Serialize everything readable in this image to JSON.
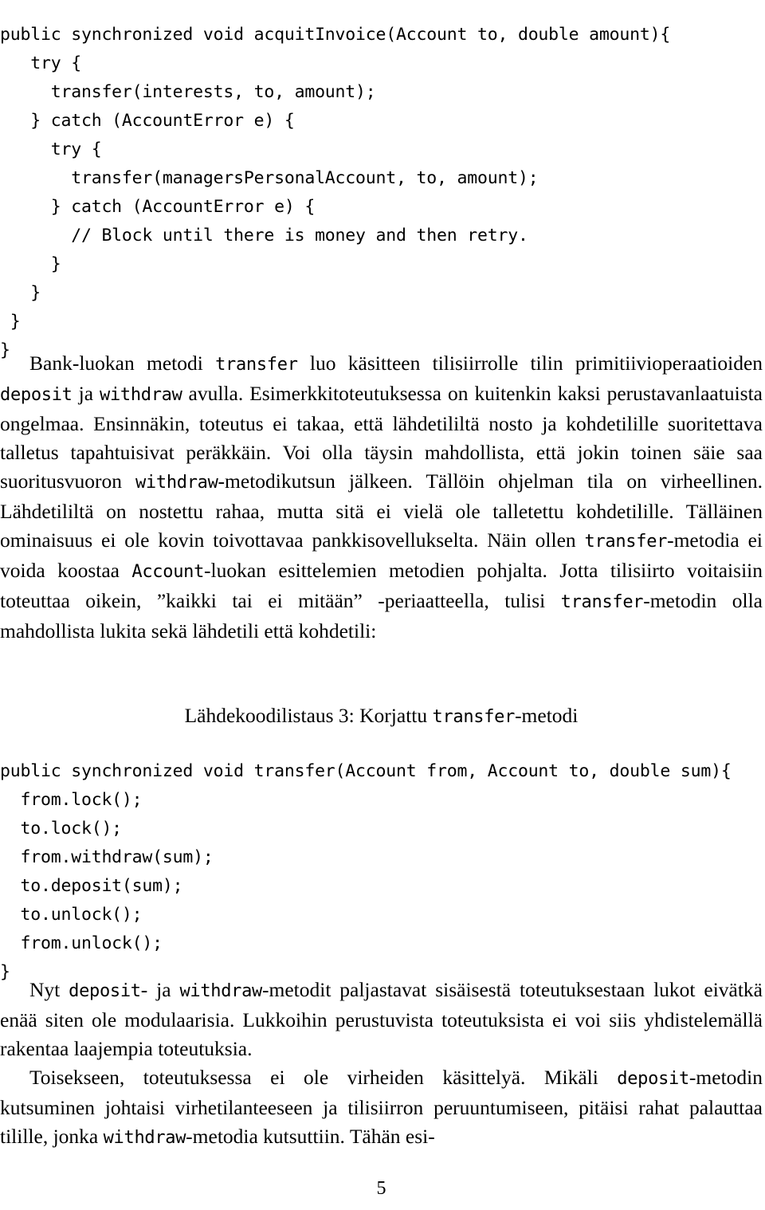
{
  "page": {
    "number": "5",
    "language": "fi"
  },
  "code_listing_1": {
    "language": "java",
    "lines": [
      "public synchronized void acquitInvoice(Account to, double amount){",
      "   try {",
      "     transfer(interests, to, amount);",
      "   } catch (AccountError e) {",
      "     try {",
      "       transfer(managersPersonalAccount, to, amount);",
      "     } catch (AccountError e) {",
      "       // Block until there is money and then retry.",
      "     }",
      "   }",
      " }",
      "}"
    ]
  },
  "paragraph_1": {
    "runs": [
      {
        "t": "Bank-luokan metodi ",
        "m": false
      },
      {
        "t": "transfer",
        "m": true
      },
      {
        "t": " luo käsitteen tilisiirrolle tilin primitiivioperaatioiden ",
        "m": false
      },
      {
        "t": "deposit",
        "m": true
      },
      {
        "t": " ja ",
        "m": false
      },
      {
        "t": "withdraw",
        "m": true
      },
      {
        "t": " avulla. Esimerkkitoteutuksessa on kuitenkin kaksi perustavanlaatuista ongelmaa. Ensinnäkin, toteutus ei takaa, että lähdetililtä nosto ja kohdetilille suoritettava talletus tapahtuisivat peräkkäin. Voi olla täysin mahdollista, että jokin toinen säie saa suoritusvuoron ",
        "m": false
      },
      {
        "t": "withdraw",
        "m": true
      },
      {
        "t": "-metodikutsun jälkeen. Tällöin ohjelman tila on virheellinen. Lähdetililtä on nostettu rahaa, mutta sitä ei vielä ole talletettu kohdetilille. Tälläinen ominaisuus ei ole kovin toivottavaa pankkisovellukselta. Näin ollen ",
        "m": false
      },
      {
        "t": "transfer",
        "m": true
      },
      {
        "t": "-metodia ei voida koostaa ",
        "m": false
      },
      {
        "t": "Account",
        "m": true
      },
      {
        "t": "-luokan esittelemien metodien pohjalta. Jotta tilisiirto voitaisiin toteuttaa oikein, ”kaikki tai ei mitään” -periaatteella, tulisi ",
        "m": false
      },
      {
        "t": "transfer",
        "m": true
      },
      {
        "t": "-metodin olla mahdollista lukita sekä lähdetili että kohdetili:",
        "m": false
      }
    ]
  },
  "listing_caption": {
    "runs": [
      {
        "t": "Lähdekoodilistaus 3: Korjattu ",
        "m": false
      },
      {
        "t": "transfer",
        "m": true
      },
      {
        "t": "-metodi",
        "m": false
      }
    ]
  },
  "code_listing_2": {
    "language": "java",
    "lines": [
      "public synchronized void transfer(Account from, Account to, double sum){",
      "  from.lock();",
      "  to.lock();",
      "  from.withdraw(sum);",
      "  to.deposit(sum);",
      "  to.unlock();",
      "  from.unlock();",
      "}"
    ]
  },
  "paragraph_2": {
    "runs": [
      {
        "t": "Nyt ",
        "m": false
      },
      {
        "t": "deposit",
        "m": true
      },
      {
        "t": "- ja ",
        "m": false
      },
      {
        "t": "withdraw",
        "m": true
      },
      {
        "t": "-metodit paljastavat sisäisestä toteutuksestaan lukot eivätkä enää siten ole modulaarisia. Lukkoihin perustuvista toteutuksista ei voi siis yhdistelemällä rakentaa laajempia toteutuksia.",
        "m": false
      }
    ]
  },
  "paragraph_3": {
    "runs": [
      {
        "t": "Toisekseen, toteutuksessa ei ole virheiden käsittelyä. Mikäli ",
        "m": false
      },
      {
        "t": "deposit",
        "m": true
      },
      {
        "t": "-metodin kutsuminen johtaisi virhetilanteeseen ja tilisiirron peruuntumiseen, pitäisi rahat palauttaa tilille, jonka ",
        "m": false
      },
      {
        "t": "withdraw",
        "m": true
      },
      {
        "t": "-metodia kutsuttiin. Tähän esi-",
        "m": false
      }
    ]
  }
}
